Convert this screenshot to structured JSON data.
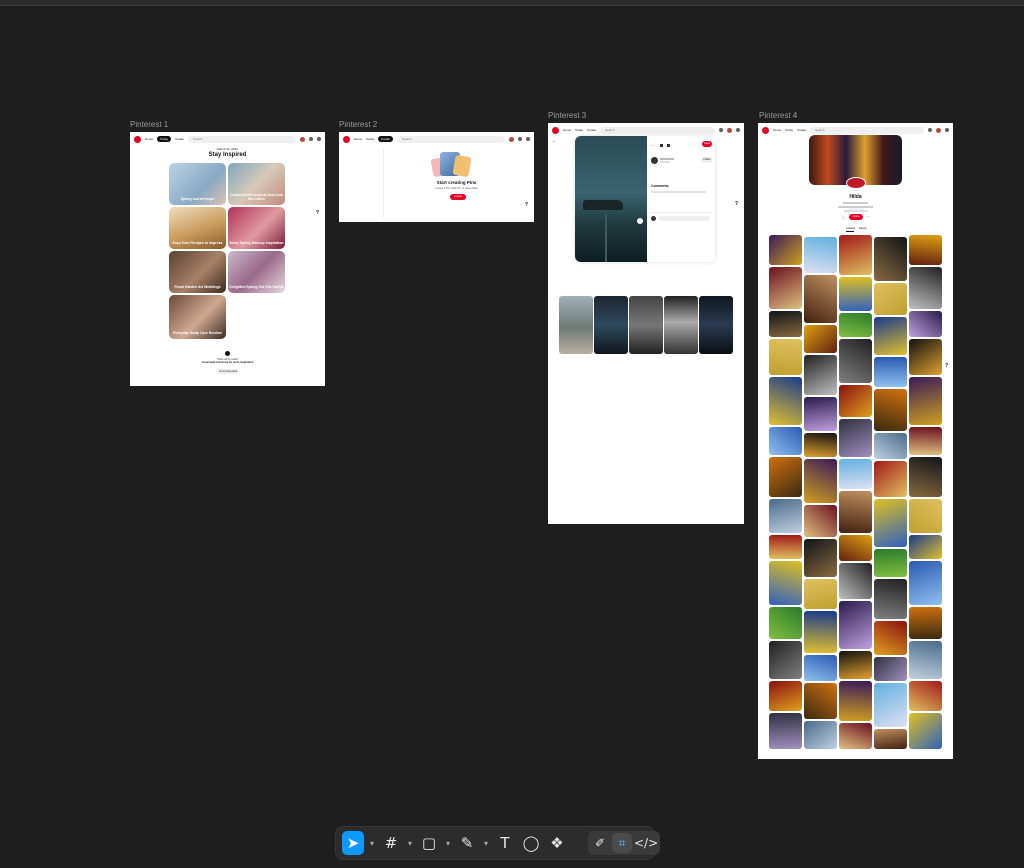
{
  "frames": {
    "f1": {
      "label": "Pinterest 1"
    },
    "f2": {
      "label": "Pinterest 2"
    },
    "f3": {
      "label": "Pinterest 3"
    },
    "f4": {
      "label": "Pinterest 4"
    }
  },
  "nav": {
    "home": "Home",
    "today": "Today",
    "create": "Create",
    "search_placeholder": "Search"
  },
  "p1": {
    "date": "March 22, 2023",
    "title": "Stay Inspired",
    "tiles": [
      "Spring nail art inspo",
      "Colourful DIY projects that look like cakes",
      "Easy Keto Recipes to Impress",
      "Dewy Spring Makeup Inspiration",
      "Floral Garden Art Weddings",
      "Delightful Spring Tea Fits Outfits",
      "Everyday Scalp Care Routine"
    ],
    "footer1": "That's all for today!",
    "footer2": "Come back tomorrow for more inspiration",
    "button": "Go to home feed"
  },
  "p2": {
    "title": "Start creating Pins",
    "sub": "Create a Pin, Idea Pin, or save ideas",
    "button": "Create"
  },
  "p3": {
    "section": "Comments",
    "follow": "Follow",
    "save": "Save"
  },
  "p4": {
    "name": "Hilda",
    "button": "Follow",
    "tab1": "Created",
    "tab2": "Saved"
  },
  "colors": {
    "accent": "#e60023",
    "figma_blue": "#0d99ff"
  }
}
